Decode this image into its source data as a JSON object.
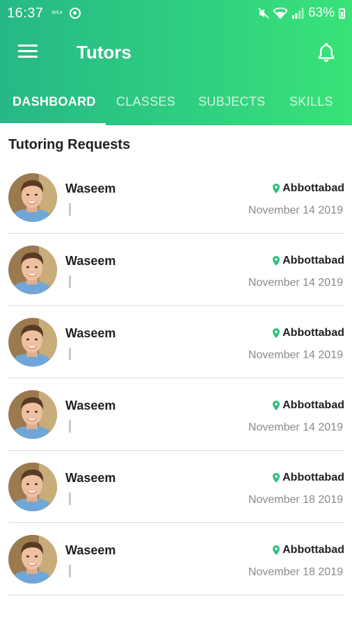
{
  "status_bar": {
    "time": "16:37",
    "small_text": "ᴮᴾᴱᴬ",
    "battery": "63%"
  },
  "app_bar": {
    "title": "Tutors"
  },
  "tabs": [
    {
      "label": "DASHBOARD",
      "active": true
    },
    {
      "label": "CLASSES",
      "active": false
    },
    {
      "label": "SUBJECTS",
      "active": false
    },
    {
      "label": "SKILLS",
      "active": false
    }
  ],
  "section": {
    "title": "Tutoring Requests"
  },
  "requests": [
    {
      "name": "Waseem",
      "location": "Abbottabad",
      "date": "November 14 2019"
    },
    {
      "name": "Waseem",
      "location": "Abbottabad",
      "date": "November 14 2019"
    },
    {
      "name": "Waseem",
      "location": "Abbottabad",
      "date": "November 14 2019"
    },
    {
      "name": "Waseem",
      "location": "Abbottabad",
      "date": "November 14 2019"
    },
    {
      "name": "Waseem",
      "location": "Abbottabad",
      "date": "November 18 2019"
    },
    {
      "name": "Waseem",
      "location": "Abbottabad",
      "date": "November 18 2019"
    }
  ],
  "colors": {
    "accent": "#27c080",
    "pin": "#2fbf7c",
    "divider": "#dcdcdc",
    "date_text": "#8a8a8a"
  },
  "icons": {
    "menu": "hamburger-menu-icon",
    "notifications": "bell-icon",
    "location": "location-pin-icon"
  }
}
